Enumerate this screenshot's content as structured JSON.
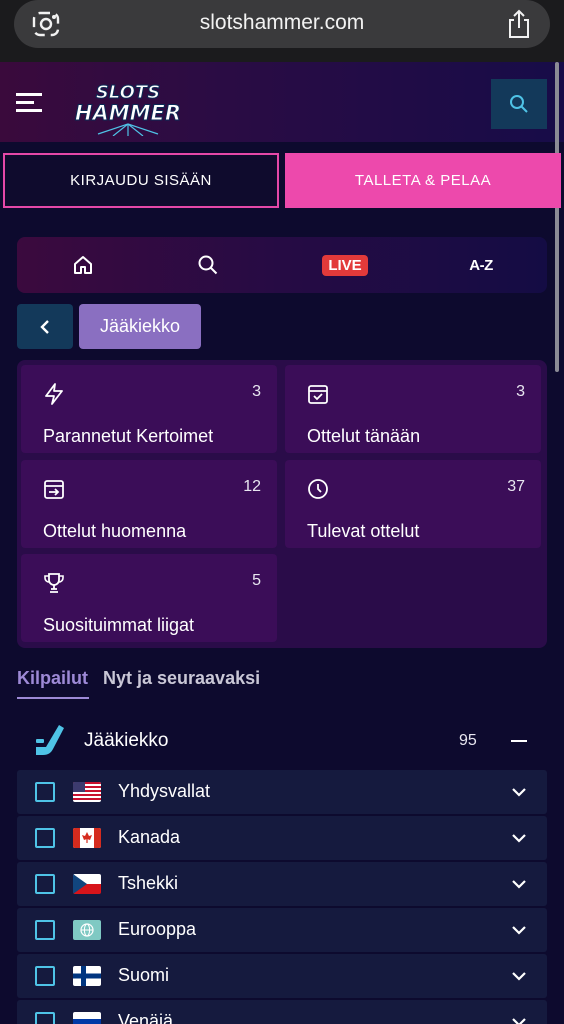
{
  "browser": {
    "url": "slotshammer.com"
  },
  "header": {
    "logo_text": "SLOTS HAMMER"
  },
  "auth": {
    "login_label": "KIRJAUDU SISÄÄN",
    "deposit_label": "TALLETA & PELAA"
  },
  "nav": {
    "live_label": "LIVE",
    "az_label": "A-Z"
  },
  "breadcrumb": {
    "current": "Jääkiekko"
  },
  "categories": [
    {
      "label": "Parannetut Kertoimet",
      "count": "3",
      "icon": "bolt-icon"
    },
    {
      "label": "Ottelut tänään",
      "count": "3",
      "icon": "calendar-check-icon"
    },
    {
      "label": "Ottelut huomenna",
      "count": "12",
      "icon": "calendar-arrow-icon"
    },
    {
      "label": "Tulevat ottelut",
      "count": "37",
      "icon": "clock-icon"
    },
    {
      "label": "Suosituimmat liigat",
      "count": "5",
      "icon": "trophy-icon"
    }
  ],
  "tabs": {
    "active": "Kilpailut",
    "inactive": "Nyt ja seuraavaksi"
  },
  "sport": {
    "label": "Jääkiekko",
    "count": "95",
    "icon": "hockey-stick-icon"
  },
  "countries": [
    {
      "label": "Yhdysvallat",
      "flag": "us-flag-icon"
    },
    {
      "label": "Kanada",
      "flag": "ca-flag-icon"
    },
    {
      "label": "Tshekki",
      "flag": "cz-flag-icon"
    },
    {
      "label": "Eurooppa",
      "flag": "globe-flag-icon"
    },
    {
      "label": "Suomi",
      "flag": "fi-flag-icon"
    },
    {
      "label": "Venäjä",
      "flag": "ru-flag-icon"
    }
  ],
  "colors": {
    "accent_pink": "#ed49ac",
    "accent_cyan": "#4fc3e6",
    "accent_purple": "#8a6fc1",
    "live_red": "#e23a3a"
  }
}
